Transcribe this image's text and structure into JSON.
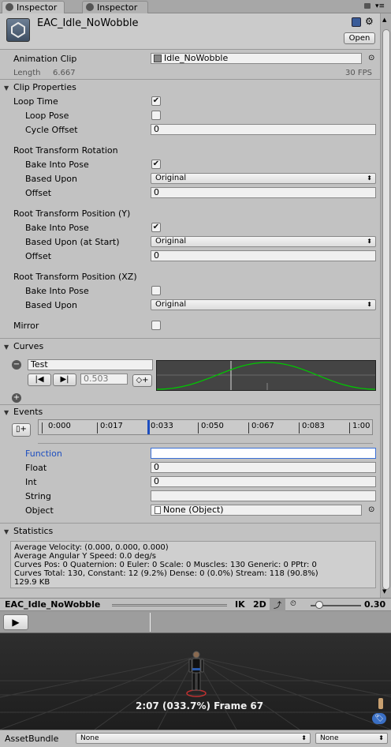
{
  "tabs": [
    {
      "label": "Inspector",
      "active": true
    },
    {
      "label": "Inspector",
      "active": false
    }
  ],
  "header": {
    "title": "EAC_Idle_NoWobble",
    "open_button": "Open"
  },
  "animation_clip": {
    "label": "Animation Clip",
    "value": "Idle_NoWobble",
    "length_label": "Length",
    "length_value": "6.667",
    "fps": "30 FPS"
  },
  "clip_properties": {
    "title": "Clip Properties",
    "loop_time": "Loop Time",
    "loop_pose": "Loop Pose",
    "cycle_offset": "Cycle Offset",
    "cycle_offset_value": "0"
  },
  "root_rotation": {
    "title": "Root Transform Rotation",
    "bake": "Bake Into Pose",
    "based_upon": "Based Upon",
    "based_upon_value": "Original",
    "offset": "Offset",
    "offset_value": "0"
  },
  "root_position_y": {
    "title": "Root Transform Position (Y)",
    "bake": "Bake Into Pose",
    "based_upon": "Based Upon (at Start)",
    "based_upon_value": "Original",
    "offset": "Offset",
    "offset_value": "0"
  },
  "root_position_xz": {
    "title": "Root Transform Position (XZ)",
    "bake": "Bake Into Pose",
    "based_upon": "Based Upon",
    "based_upon_value": "Original"
  },
  "mirror": {
    "label": "Mirror"
  },
  "curves": {
    "title": "Curves",
    "curve_name": "Test",
    "curve_value": "0.503"
  },
  "events": {
    "title": "Events",
    "ticks": [
      "0:000",
      "0:017",
      "0:033",
      "0:050",
      "0:067",
      "0:083",
      "1:00"
    ],
    "function_label": "Function",
    "function_value": "",
    "float_label": "Float",
    "float_value": "0",
    "int_label": "Int",
    "int_value": "0",
    "string_label": "String",
    "string_value": "",
    "object_label": "Object",
    "object_value": "None (Object)"
  },
  "statistics": {
    "title": "Statistics",
    "lines": [
      "Average Velocity: (0.000, 0.000, 0.000)",
      "Average Angular Y Speed: 0.0 deg/s",
      "Curves Pos: 0 Quaternion: 0 Euler: 0 Scale: 0 Muscles: 130 Generic: 0 PPtr: 0",
      "Curves Total: 130, Constant: 12 (9.2%) Dense: 0 (0.0%) Stream: 118 (90.8%)",
      "129.9 KB"
    ]
  },
  "preview": {
    "title": "EAC_Idle_NoWobble",
    "ik": "IK",
    "mode_2d": "2D",
    "speed": "0.30",
    "overlay": "2:07 (033.7%) Frame 67"
  },
  "footer": {
    "asset_bundle_label": "AssetBundle",
    "bundle_value": "None",
    "variant_value": "None"
  },
  "colors": {
    "curve": "#00c800",
    "selected_label": "#1d4ec0",
    "accent_field_border": "#3b6fd6"
  }
}
